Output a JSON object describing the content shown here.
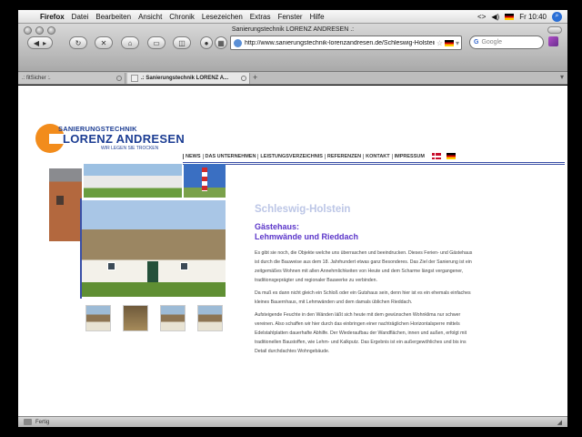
{
  "menubar": {
    "items": [
      "Firefox",
      "Datei",
      "Bearbeiten",
      "Ansicht",
      "Chronik",
      "Lesezeichen",
      "Extras",
      "Fenster",
      "Hilfe"
    ],
    "clock": "Fr 10:40"
  },
  "window": {
    "title": "Sanierungstechnik LORENZ ANDRESEN .:"
  },
  "toolbar": {
    "url": "http://www.sanierungstechnik-lorenzandresen.de/Schleswig-Holstein_0",
    "search_placeholder": "Google"
  },
  "tabs": [
    {
      "label": ".: fitSicher :."
    },
    {
      "label": ".: Sanierungstechnik LORENZ A..."
    }
  ],
  "site": {
    "logo_top": "SANIERUNGSTECHNIK",
    "logo_main": "LORENZ ANDRESEN",
    "logo_tagline": "WIR LEGEN SIE TROCKEN",
    "nav": [
      "NEWS",
      "DAS UNTERNEHMEN",
      "LEISTUNGSVERZEICHNIS",
      "REFERENZEN",
      "KONTAKT",
      "IMPRESSUM"
    ],
    "region": "Schleswig-Holstein",
    "heading_line1": "Gästehaus:",
    "heading_line2": "Lehmwände und Rieddach",
    "paragraphs": [
      "Es gibt sie noch, die Objekte welche uns überraschen und beeindrucken. Dieses Ferien- und Gästehaus ist durch die Bauweise aus dem 18. Jahrhundert etwas ganz Besonderes. Das Ziel der Sanierung ist ein zeitgemäßes Wohnen mit allen Annehmlichkeiten von Heute und dem Scharme längst vergangener, traditionsgeprägter und regionaler Bauwerke zu verbinden.",
      "Da muß es dann nicht gleich ein Schloß oder ein Gutshaus sein, denn hier ist es ein ehemals einfaches kleines Bauernhaus, mit Lehmwänden und dem damals üblichen Rieddach.",
      "Aufsteigende Feuchte in den Wänden läßt sich heute mit dem gewünschen Wohnklima nur schwer vereinen. Also schaffen wir hier durch das einbringen einer nachträglichen Horizontalsperre mittels Edelstahlplatten dauerhafte Abhilfe. Der Wiederaufbau der Wandflächen, innen und außen, erfolgt mit traditionellen Baustoffen, wie Lehm- und Kalkputz. Das Ergebnis ist ein außergewöhliches und bis ins Detail durchdachtes Wohngebäude."
    ]
  },
  "status": {
    "text": "Fertig"
  }
}
